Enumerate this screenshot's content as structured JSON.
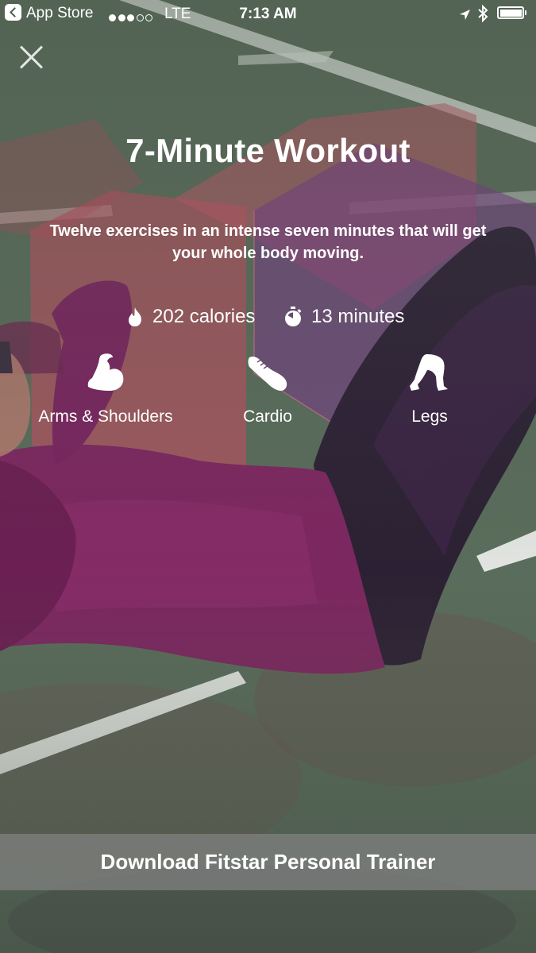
{
  "status_bar": {
    "back_app": "App Store",
    "signal_bars": 3,
    "signal_total": 5,
    "network": "LTE",
    "time": "7:13 AM",
    "battery_level": 1.0
  },
  "workout": {
    "title": "7-Minute Workout",
    "description": "Twelve exercises in an intense seven minutes that will get your whole body moving.",
    "stats": {
      "calories": "202 calories",
      "duration": "13 minutes"
    },
    "categories": [
      {
        "label": "Arms & Shoulders",
        "icon": "flexed-arm-icon"
      },
      {
        "label": "Cardio",
        "icon": "running-shoe-icon"
      },
      {
        "label": "Legs",
        "icon": "lunge-legs-icon"
      }
    ]
  },
  "download_button": {
    "label": "Download Fitstar Personal Trainer"
  },
  "colors": {
    "overlay_red": "#c04f62",
    "overlay_purple": "#6a2a7a",
    "shirt_magenta": "#7d2760",
    "court_green": "#566757",
    "button_bg": "#828282"
  }
}
